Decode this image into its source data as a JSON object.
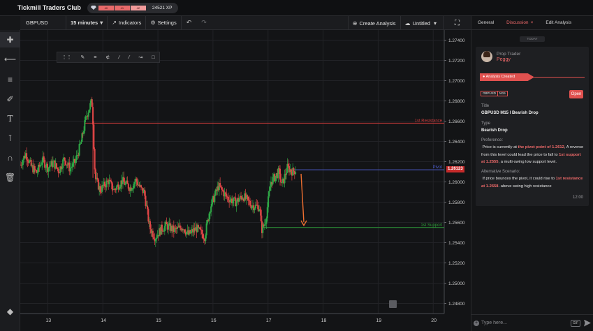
{
  "app": {
    "title": "Tickmill Traders Club",
    "xp_levels": [
      "40",
      "41",
      "42"
    ],
    "xp_total": "24521 XP"
  },
  "toolbar": {
    "symbol": "GBPUSD",
    "timeframe": "15 minutes",
    "indicators": "Indicators",
    "settings": "Settings",
    "create_analysis": "Create Analysis",
    "layout_name": "Untitled"
  },
  "chart_data": {
    "type": "candlestick",
    "symbol": "GBPUSD",
    "interval": "15 minutes",
    "x_ticks": [
      "13",
      "14",
      "15",
      "16",
      "17",
      "18",
      "19",
      "20"
    ],
    "y_ticks": [
      "1.27400",
      "1.27200",
      "1.27000",
      "1.26800",
      "1.26600",
      "1.26400",
      "1.26200",
      "1.26000",
      "1.25800",
      "1.25600",
      "1.25400",
      "1.25200",
      "1.25000",
      "1.24800"
    ],
    "ylim": [
      1.247,
      1.275
    ],
    "current_price": "1.26123",
    "levels": [
      {
        "name": "1st Resistance",
        "value": 1.2658,
        "color": "#c93a3a"
      },
      {
        "name": "Pivot",
        "value": 1.2612,
        "color": "#4c5bc9"
      },
      {
        "name": "1st Support",
        "value": 1.2555,
        "color": "#2f9b3a"
      }
    ],
    "path": [
      [
        12.5,
        1.2617
      ],
      [
        12.6,
        1.2628
      ],
      [
        12.7,
        1.2615
      ],
      [
        12.8,
        1.2609
      ],
      [
        12.9,
        1.2622
      ],
      [
        13.0,
        1.2614
      ],
      [
        13.1,
        1.2619
      ],
      [
        13.2,
        1.2611
      ],
      [
        13.3,
        1.2623
      ],
      [
        13.4,
        1.2613
      ],
      [
        13.5,
        1.262
      ],
      [
        13.6,
        1.2638
      ],
      [
        13.7,
        1.2665
      ],
      [
        13.8,
        1.268
      ],
      [
        13.82,
        1.266
      ],
      [
        13.86,
        1.2604
      ],
      [
        13.95,
        1.2592
      ],
      [
        14.1,
        1.2601
      ],
      [
        14.2,
        1.2592
      ],
      [
        14.35,
        1.2601
      ],
      [
        14.5,
        1.2594
      ],
      [
        14.6,
        1.2602
      ],
      [
        14.7,
        1.2592
      ],
      [
        14.75,
        1.259
      ],
      [
        14.85,
        1.2555
      ],
      [
        14.95,
        1.2545
      ],
      [
        15.05,
        1.2553
      ],
      [
        15.15,
        1.2557
      ],
      [
        15.3,
        1.2552
      ],
      [
        15.45,
        1.2556
      ],
      [
        15.55,
        1.2548
      ],
      [
        15.7,
        1.2554
      ],
      [
        15.85,
        1.2546
      ],
      [
        15.95,
        1.2575
      ],
      [
        16.1,
        1.2596
      ],
      [
        16.25,
        1.2585
      ],
      [
        16.4,
        1.258
      ],
      [
        16.55,
        1.2586
      ],
      [
        16.7,
        1.2577
      ],
      [
        16.85,
        1.2575
      ],
      [
        16.88,
        1.2552
      ],
      [
        16.95,
        1.256
      ],
      [
        17.05,
        1.26
      ],
      [
        17.2,
        1.261
      ],
      [
        17.25,
        1.2596
      ],
      [
        17.35,
        1.2614
      ],
      [
        17.45,
        1.261
      ],
      [
        17.5,
        1.2612
      ]
    ],
    "forecast_arrow": {
      "from": [
        17.6,
        1.2608
      ],
      "to": [
        17.65,
        1.2557
      ]
    },
    "xlim": [
      12.5,
      20.2
    ],
    "grid": true
  },
  "panel": {
    "tabs": [
      "General",
      "Discussion",
      "Edit Analysis"
    ],
    "today": "TODAY",
    "user_role": "Prop Trader",
    "user_name": "Peggy",
    "event": "Analysis Created",
    "tags": [
      "GBPUSD",
      "M15"
    ],
    "open_label": "Open",
    "title_label": "Title",
    "title_value": "GBPUSD M15 I Bearish Drop",
    "type_label": "Type",
    "type_value": "Bearish Drop",
    "preference_label": "Preference:",
    "preference_p1": "Price is currently at ",
    "preference_h1": "the pivot point of 1.2612",
    "preference_p2": ", A reverse from this level could lead the price to fall to ",
    "preference_h2": "1st support at 1.2555",
    "preference_p3": ", a multi-swing low support level.",
    "alt_label": "Alternative Scenario:",
    "alt_p1": "If price bounces the pivot, it could rise to ",
    "alt_h1": "1st resistance at 1.2658",
    "alt_p2": ". above swing high resistance",
    "time": "12:00",
    "input_placeholder": "Type here...",
    "gif_label": "GIF"
  }
}
